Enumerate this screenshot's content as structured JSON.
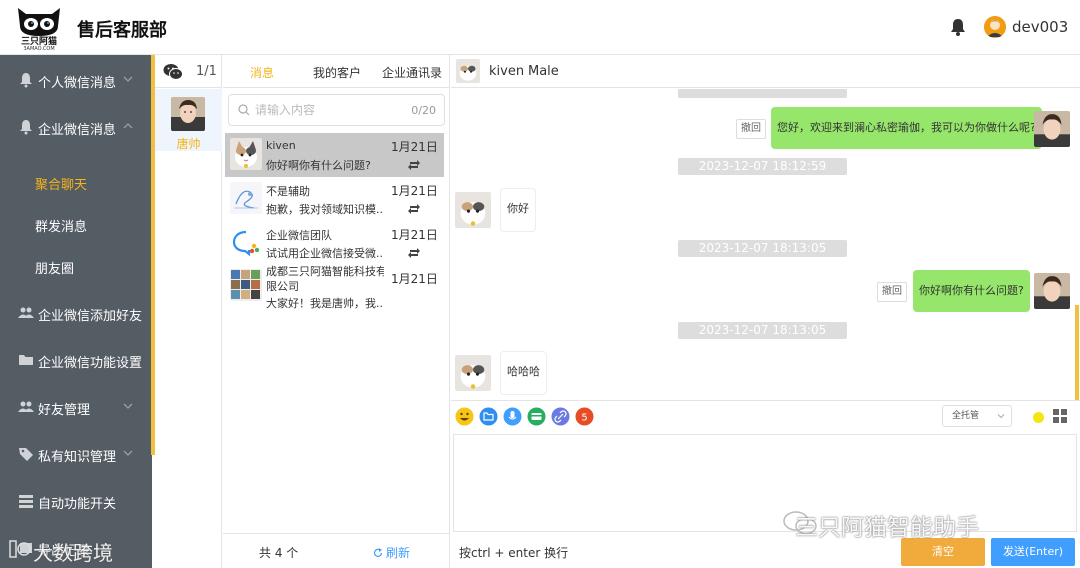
{
  "header": {
    "logo_text": "三只阿猫",
    "logo_sub": "3AMAO.COM",
    "title": "售后客服部",
    "username": "dev003"
  },
  "nav": {
    "items": [
      {
        "label": "个人微信消息",
        "icon": "bell-icon"
      },
      {
        "label": "企业微信消息",
        "icon": "bell-icon"
      },
      {
        "label": "企业微信添加好友",
        "icon": "users-icon"
      },
      {
        "label": "企业微信功能设置",
        "icon": "folder-icon"
      },
      {
        "label": "好友管理",
        "icon": "users-icon"
      },
      {
        "label": "私有知识管理",
        "icon": "tag-icon"
      },
      {
        "label": "自动功能开关",
        "icon": "server-icon"
      },
      {
        "label": "导出记录",
        "icon": "export-icon"
      }
    ],
    "sub_items": [
      {
        "label": "聚合聊天",
        "active": true
      },
      {
        "label": "群发消息",
        "active": false
      },
      {
        "label": "朋友圈",
        "active": false
      }
    ]
  },
  "contacts": {
    "count": "1/1",
    "items": [
      {
        "name": "唐帅"
      }
    ]
  },
  "sessions": {
    "tabs": [
      "消息",
      "我的客户",
      "企业通讯录"
    ],
    "search_placeholder": "请输入内容",
    "search_count": "0/20",
    "list": [
      {
        "name": "kiven",
        "preview": "你好啊你有什么问题?",
        "date": "1月21日",
        "active": true,
        "avatar": "cat"
      },
      {
        "name": "不是辅助",
        "preview": "抱歉，我对领域知识模...",
        "date": "1月21日",
        "active": false,
        "avatar": "sketch"
      },
      {
        "name": "企业微信团队",
        "preview": "试试用企业微信接受微...",
        "date": "1月21日",
        "active": false,
        "avatar": "wecom"
      },
      {
        "name": "成都三只阿猫智能科技有",
        "name2": "限公司",
        "preview": "大家好！我是唐帅，我...",
        "date": "1月21日",
        "active": false,
        "avatar": "grid"
      }
    ],
    "total": "共 4 个",
    "refresh": "刷新"
  },
  "chat": {
    "peer_name": "kiven",
    "peer_gender": "Male",
    "messages": [
      {
        "type": "out",
        "text": "您好，欢迎来到澜心私密瑜伽，我可以为你做什么呢?",
        "recall": "撤回"
      },
      {
        "type": "time",
        "text": "2023-12-07 18:12:59"
      },
      {
        "type": "in",
        "text": "你好"
      },
      {
        "type": "time",
        "text": "2023-12-07 18:13:05"
      },
      {
        "type": "out",
        "text": "你好啊你有什么问题?",
        "recall": "撤回"
      },
      {
        "type": "time",
        "text": "2023-12-07 18:13:05"
      },
      {
        "type": "in",
        "text": "哈哈哈"
      }
    ],
    "composer": {
      "mode": "全托管",
      "hint": "按ctrl + enter 换行",
      "clear": "清空",
      "send": "发送(Enter)"
    }
  },
  "watermarks": {
    "wechat_account": "三只阿猫智能助手",
    "brand": "大数跨境"
  },
  "colors": {
    "accent": "#f5b41b",
    "nav_bg": "#545c64",
    "bubble_out": "#95e66b",
    "send": "#409eff",
    "clear": "#f0ab3c"
  }
}
